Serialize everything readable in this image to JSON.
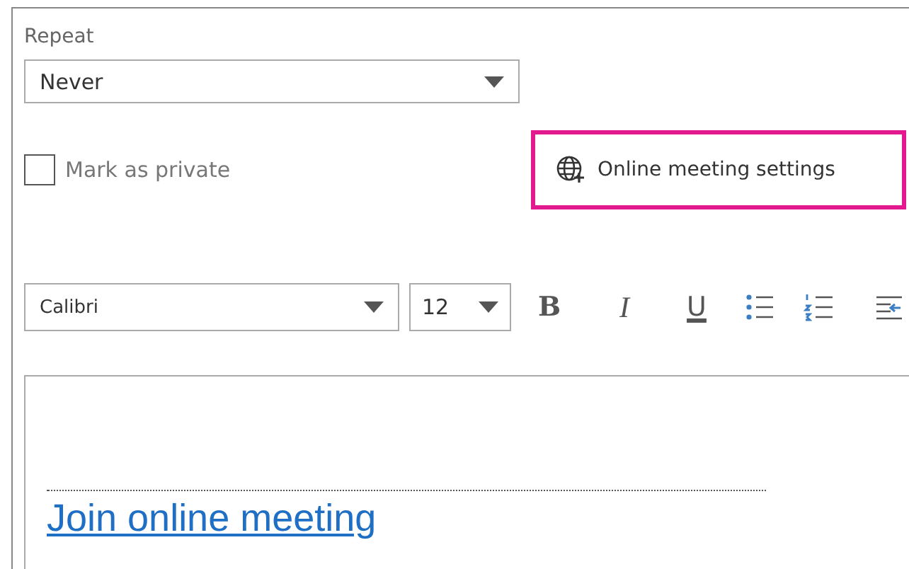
{
  "repeat": {
    "label": "Repeat",
    "value": "Never"
  },
  "private": {
    "label": "Mark as private",
    "checked": false
  },
  "online_meeting": {
    "label": "Online meeting settings"
  },
  "toolbar": {
    "font": "Calibri",
    "size": "12",
    "buttons": [
      {
        "kind": "bold",
        "label": "B"
      },
      {
        "kind": "italic",
        "label": "I"
      },
      {
        "kind": "underline",
        "label": "U"
      },
      {
        "kind": "bullets"
      },
      {
        "kind": "numbering"
      },
      {
        "kind": "indent"
      }
    ]
  },
  "body": {
    "link": "Join online meeting"
  }
}
